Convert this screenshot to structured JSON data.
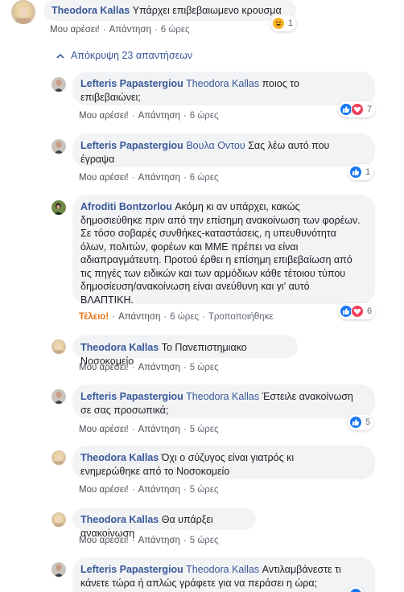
{
  "top": {
    "author": "Theodora Kallas",
    "text": "Υπάρχει επιβεβαιωμενο κρουσμα",
    "like": "Μου αρέσει!",
    "reply": "Απάντηση",
    "time": "6 ώρες",
    "react_count": "1"
  },
  "toggle": {
    "label": "Απόκρυψη 23 απαντήσεων"
  },
  "replies": [
    {
      "author": "Lefteris Papastergiou",
      "mention": "Theodora Kallas",
      "line1": " ποιος το",
      "line2": "επιβεβαιώνει;",
      "like": "Μου αρέσει!",
      "reply": "Απάντηση",
      "time": "6 ώρες",
      "react_count": "7"
    },
    {
      "author": "Lefteris Papastergiou",
      "mention": "Βουλα Οντου",
      "line1": " Σας λέω αυτό που",
      "line2": "έγραψα",
      "like": "Μου αρέσει!",
      "reply": "Απάντηση",
      "time": "6 ώρες",
      "react_count": "1"
    },
    {
      "author": "Afroditi Bontzorlou",
      "line1": " Ακόμη κι αν υπάρχει, κακώς",
      "lines": [
        "δημοσιεύθηκε πριν από την επίσημη ανακοίνωση των φορέων.",
        "Σε τόσο σοβαρές συνθήκες-καταστάσεις, η υπευθυνότητα",
        "όλων, πολιτών, φορέων και ΜΜΕ πρέπει να είναι",
        "αδιαπραγμάτευτη. Προτού έρθει η επίσημη επιβεβαίωση από",
        "τις πηγές των ειδικών και των αρμόδιων κάθε τέτοιου τύπου",
        "δημοσίευση/ανακοίνωση είναι ανεύθυνη και γι' αυτό",
        "ΒΛΑΠΤΙΚΗ."
      ],
      "like": "Τέλειο!",
      "reply": "Απάντηση",
      "time": "6 ώρες",
      "edited": "Τροποποιήθηκε",
      "react_count": "6"
    },
    {
      "author": "Theodora Kallas",
      "line1": " Το Πανεπιστημιακο Νοσοκομείο",
      "like": "Μου αρέσει!",
      "reply": "Απάντηση",
      "time": "5 ώρες"
    },
    {
      "author": "Lefteris Papastergiou",
      "mention": "Theodora Kallas",
      "line1": " Έστειλε ανακοίνωση",
      "line2": "σε σας προσωπικά;",
      "like": "Μου αρέσει!",
      "reply": "Απάντηση",
      "time": "5 ώρες",
      "react_count": "5"
    },
    {
      "author": "Theodora Kallas",
      "line1": " Όχι ο σύζυγος είναι γιατρός κι",
      "line2": "ενημερώθηκε από το Νοσοκομείο",
      "like": "Μου αρέσει!",
      "reply": "Απάντηση",
      "time": "5 ώρες"
    },
    {
      "author": "Theodora Kallas",
      "line1": " Θα υπάρξει ανακοίνωση",
      "like": "Μου αρέσει!",
      "reply": "Απάντηση",
      "time": "5 ώρες"
    },
    {
      "author": "Lefteris Papastergiou",
      "mention": "Theodora Kallas",
      "line1": " Αντιλαμβάνεστε τι",
      "line2": "κάνετε τώρα ή απλώς γράφετε για να περάσει η ώρα;"
    }
  ],
  "colors": {
    "link": "#385898",
    "bubble": "#f2f3f5",
    "like": "#1877f2",
    "love": "#f33e58",
    "haha": "#f7b125",
    "liked": "#e9710f"
  },
  "icons": [
    "woman-avatar",
    "man-avatar",
    "afroditi-avatar",
    "chevron-up-icon",
    "like-icon",
    "love-icon",
    "haha-icon"
  ]
}
